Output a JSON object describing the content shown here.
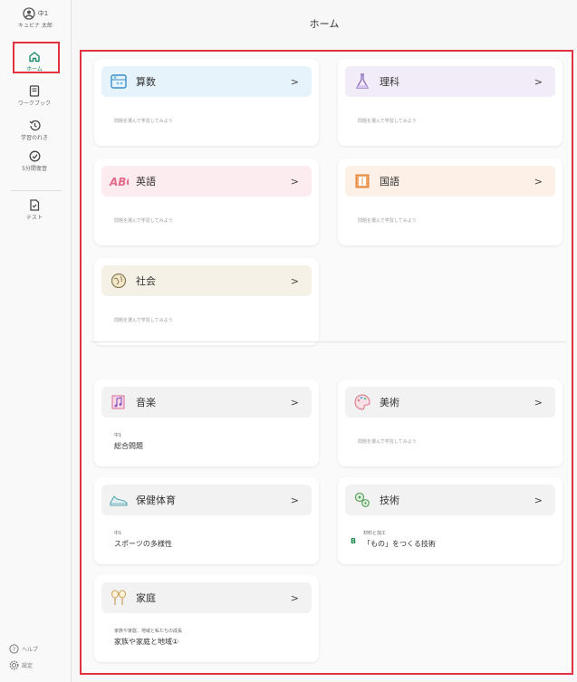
{
  "header": {
    "title": "ホーム"
  },
  "sidebar": {
    "user": {
      "grade": "中1",
      "name": "キュビナ 太郎"
    },
    "items": [
      {
        "label": "ホーム",
        "icon": "home-icon"
      },
      {
        "label": "ワークブック",
        "icon": "book-icon"
      },
      {
        "label": "学習のれき",
        "icon": "history-icon"
      },
      {
        "label": "5分間復習",
        "icon": "check-circle-icon"
      },
      {
        "label": "テスト",
        "icon": "document-icon"
      }
    ],
    "help": "ヘルプ",
    "settings": "設定"
  },
  "subjects_main": [
    {
      "title": "算数",
      "sub": "問題を選んで学習してみよう",
      "color": "#e6f3fb",
      "icon": "abacus-icon"
    },
    {
      "title": "理科",
      "sub": "問題を選んで学習してみよう",
      "color": "#f1ecf7",
      "icon": "flask-icon"
    },
    {
      "title": "英語",
      "sub": "問題を選んで学習してみよう",
      "color": "#fdecef",
      "icon": "abc-icon"
    },
    {
      "title": "国語",
      "sub": "問題を選んで学習してみよう",
      "color": "#fdf0e6",
      "icon": "notebook-icon"
    },
    {
      "title": "社会",
      "sub": "問題を選んで学習してみよう",
      "color": "#f5f1e6",
      "icon": "globe-icon"
    }
  ],
  "subjects_extra": [
    {
      "title": "音楽",
      "grade": "中1",
      "task": "総合問題",
      "color": "#f2f2f3",
      "icon": "music-icon"
    },
    {
      "title": "美術",
      "sub": "問題を選んで学習してみよう",
      "color": "#f2f2f3",
      "icon": "palette-icon"
    },
    {
      "title": "保健体育",
      "grade": "中1",
      "task": "スポーツの多様性",
      "color": "#f2f2f3",
      "icon": "shoe-icon"
    },
    {
      "title": "技術",
      "grade": "材料と加工",
      "task": "「もの」をつくる技術",
      "badge": "B",
      "color": "#f2f2f3",
      "icon": "gears-icon"
    },
    {
      "title": "家庭",
      "grade": "家族や家庭、地域と私たちの成長",
      "task": "家族や家庭と地域①",
      "color": "#f2f2f3",
      "icon": "chopsticks-icon"
    }
  ],
  "chevron": ">"
}
